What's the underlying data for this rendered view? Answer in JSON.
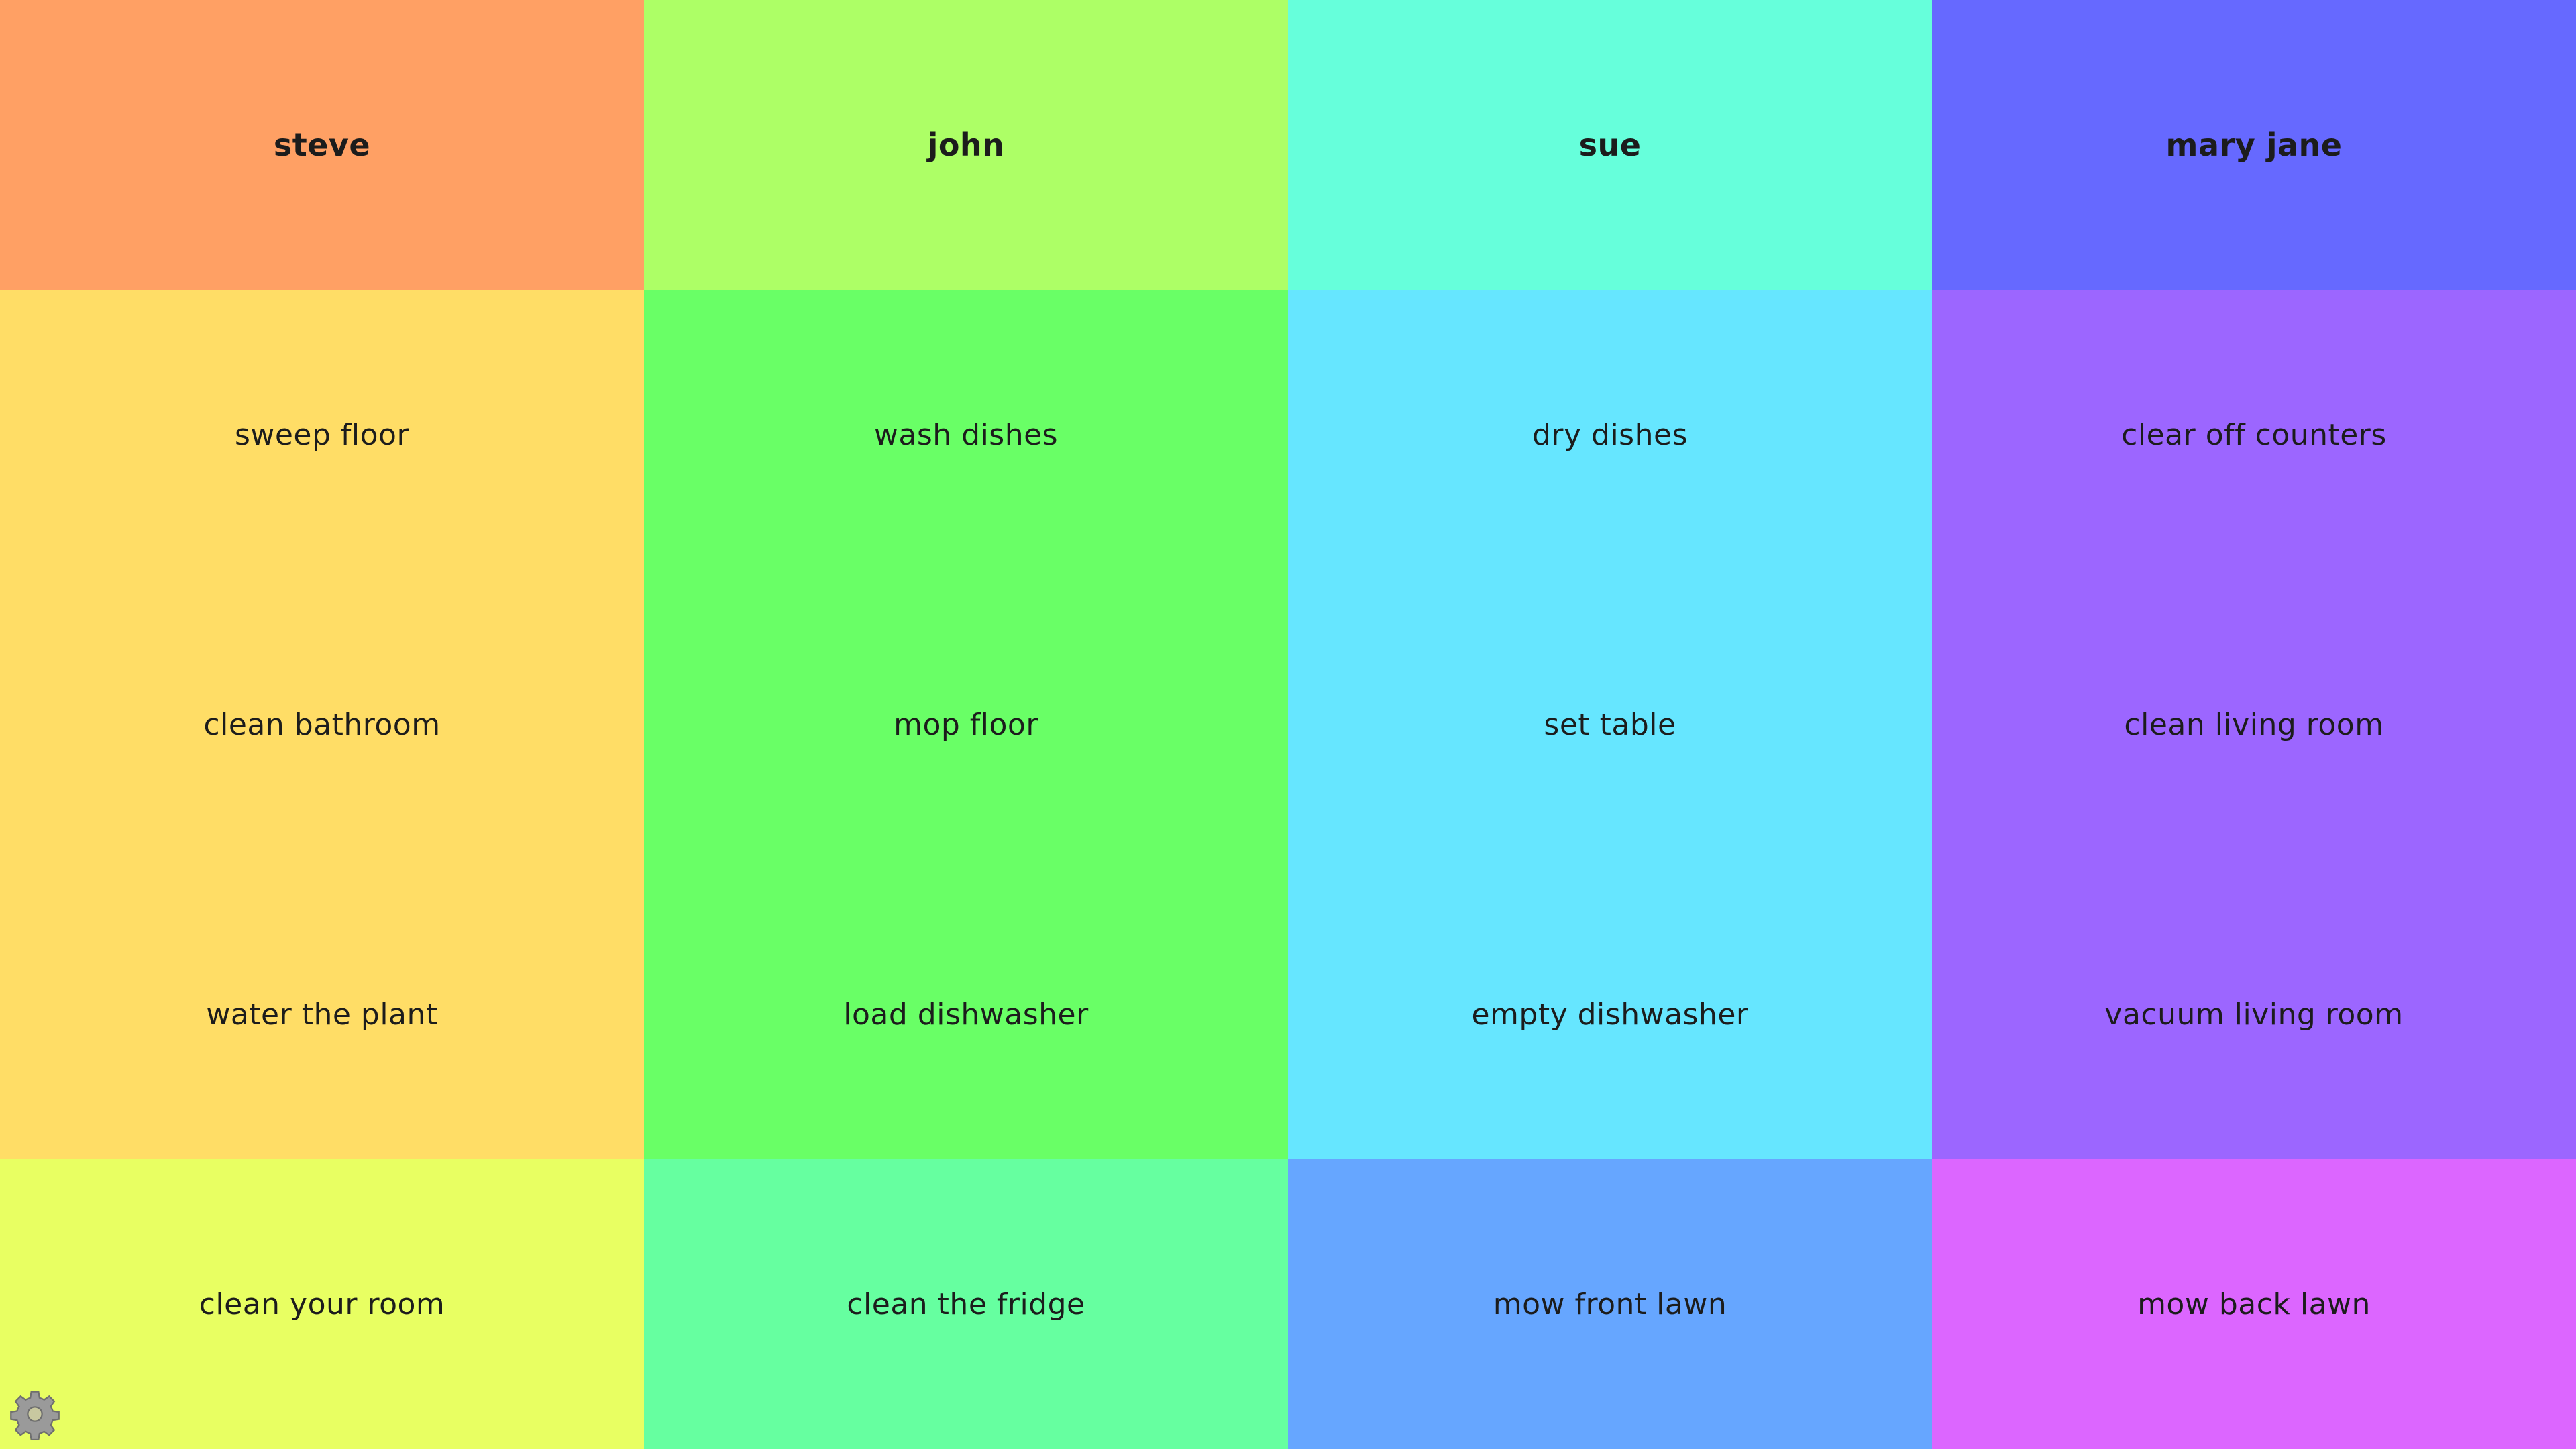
{
  "columns": [
    {
      "name": "steve",
      "header_color": "#ffa064",
      "task_color": "#ffdd66",
      "tasks": [
        "sweep floor",
        "clean bathroom",
        "water the plant"
      ],
      "extra_task": "clean your room",
      "extra_color": "#e8ff62"
    },
    {
      "name": "john",
      "header_color": "#adff66",
      "task_color": "#69ff66",
      "tasks": [
        "wash dishes",
        "mop floor",
        "load dishwasher"
      ],
      "extra_task": "clean the fridge",
      "extra_color": "#66ffa0"
    },
    {
      "name": "sue",
      "header_color": "#66ffdb",
      "task_color": "#66e6ff",
      "tasks": [
        "dry dishes",
        "set table",
        "empty dishwasher"
      ],
      "extra_task": "mow front lawn",
      "extra_color": "#66a6ff"
    },
    {
      "name": "mary jane",
      "header_color": "#6669ff",
      "task_color": "#9c66ff",
      "tasks": [
        "clear off counters",
        "clean living room",
        "vacuum living room"
      ],
      "extra_task": "mow back lawn",
      "extra_color": "#dc66ff"
    }
  ],
  "settings": {
    "icon": "gear-icon",
    "icon_color": "#9a9a9a"
  }
}
